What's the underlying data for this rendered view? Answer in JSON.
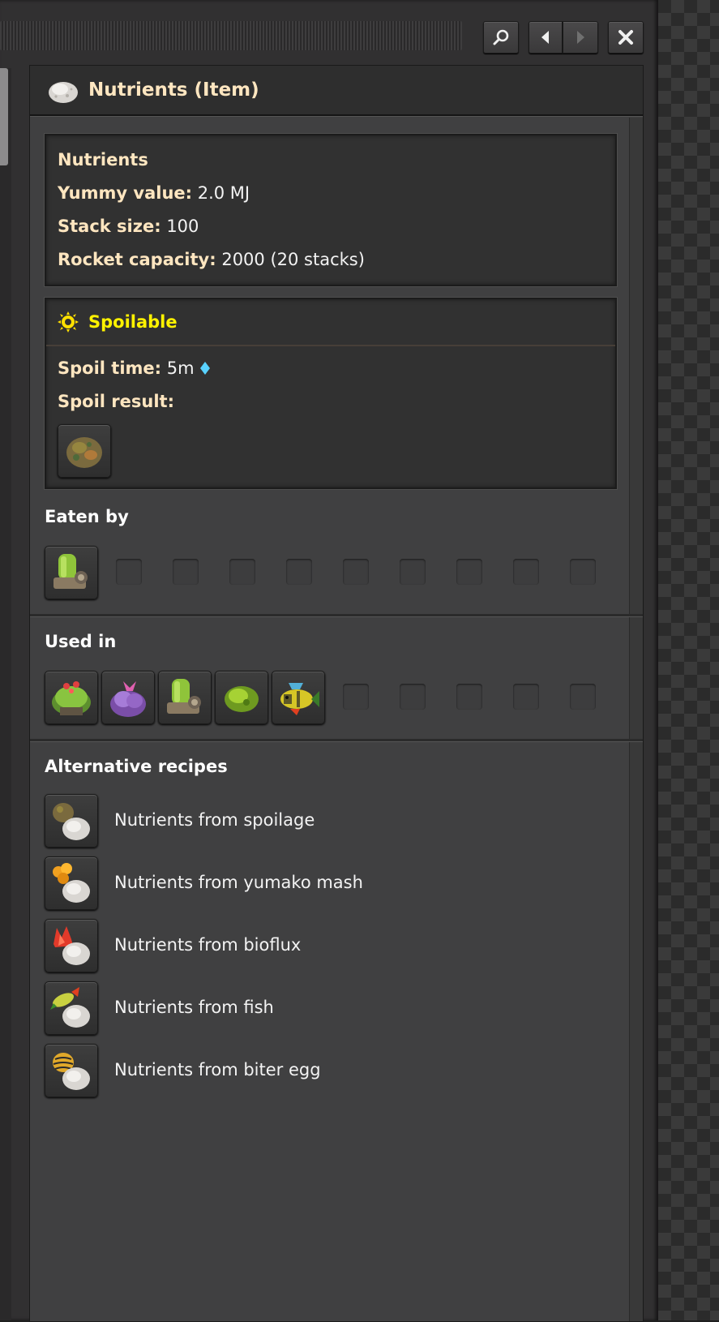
{
  "colors": {
    "label": "#ffe6c0",
    "spoilable_title": "#fff200",
    "diamond": "#59d2ff"
  },
  "header": {
    "title": "Nutrients (Item)",
    "icon": "nutrients-icon"
  },
  "toolbar": {
    "search_icon": "search-icon",
    "back_icon": "chevron-left-icon",
    "forward_icon": "chevron-right-icon",
    "close_icon": "close-icon"
  },
  "info": {
    "name": "Nutrients",
    "yummy_label": "Yummy value:",
    "yummy_value": "2.0 MJ",
    "stack_label": "Stack size:",
    "stack_value": "100",
    "rocket_label": "Rocket capacity:",
    "rocket_value": "2000 (20 stacks)"
  },
  "spoilable": {
    "title": "Spoilable",
    "spoil_time_label": "Spoil time:",
    "spoil_time_value": "5m",
    "spoil_result_label": "Spoil result:",
    "spoil_result_icon": "spoilage-icon"
  },
  "eaten_by": {
    "title": "Eaten by",
    "items": [
      "biochamber-icon"
    ]
  },
  "used_in": {
    "title": "Used in",
    "items": [
      "agricultural-tower-icon",
      "biter-egg-cluster-icon",
      "biochamber-icon",
      "pentapod-egg-icon",
      "fish-breeding-icon"
    ]
  },
  "alternative_recipes": {
    "title": "Alternative recipes",
    "items": [
      {
        "label": "Nutrients from spoilage",
        "icon": "spoilage-icon"
      },
      {
        "label": "Nutrients from yumako mash",
        "icon": "yumako-mash-icon"
      },
      {
        "label": "Nutrients from bioflux",
        "icon": "bioflux-icon"
      },
      {
        "label": "Nutrients from fish",
        "icon": "fish-icon"
      },
      {
        "label": "Nutrients from biter egg",
        "icon": "biter-egg-icon"
      }
    ]
  }
}
